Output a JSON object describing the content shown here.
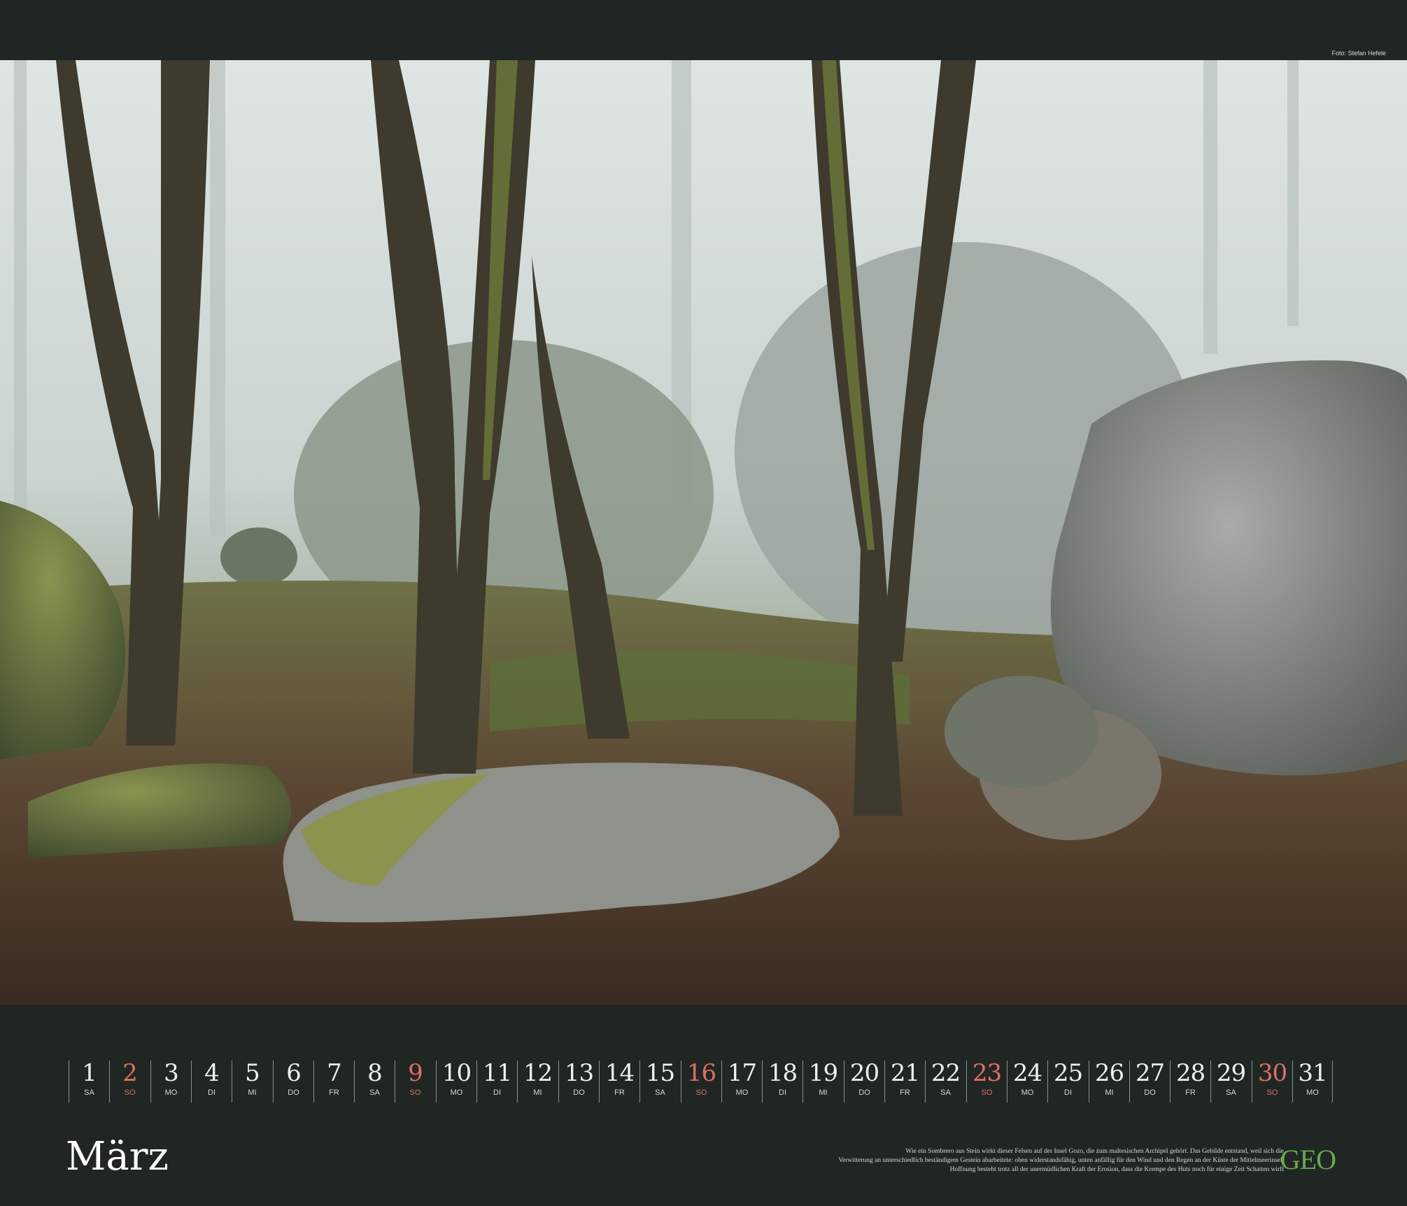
{
  "credit": "Foto: Stefan Hefele",
  "month": "März",
  "days": [
    {
      "num": "1",
      "wd": "SA",
      "sun": false
    },
    {
      "num": "2",
      "wd": "SO",
      "sun": true
    },
    {
      "num": "3",
      "wd": "MO",
      "sun": false
    },
    {
      "num": "4",
      "wd": "DI",
      "sun": false
    },
    {
      "num": "5",
      "wd": "MI",
      "sun": false
    },
    {
      "num": "6",
      "wd": "DO",
      "sun": false
    },
    {
      "num": "7",
      "wd": "FR",
      "sun": false
    },
    {
      "num": "8",
      "wd": "SA",
      "sun": false
    },
    {
      "num": "9",
      "wd": "SO",
      "sun": true
    },
    {
      "num": "10",
      "wd": "MO",
      "sun": false
    },
    {
      "num": "11",
      "wd": "DI",
      "sun": false
    },
    {
      "num": "12",
      "wd": "MI",
      "sun": false
    },
    {
      "num": "13",
      "wd": "DO",
      "sun": false
    },
    {
      "num": "14",
      "wd": "FR",
      "sun": false
    },
    {
      "num": "15",
      "wd": "SA",
      "sun": false
    },
    {
      "num": "16",
      "wd": "SO",
      "sun": true
    },
    {
      "num": "17",
      "wd": "MO",
      "sun": false
    },
    {
      "num": "18",
      "wd": "DI",
      "sun": false
    },
    {
      "num": "19",
      "wd": "MI",
      "sun": false
    },
    {
      "num": "20",
      "wd": "DO",
      "sun": false
    },
    {
      "num": "21",
      "wd": "FR",
      "sun": false
    },
    {
      "num": "22",
      "wd": "SA",
      "sun": false
    },
    {
      "num": "23",
      "wd": "SO",
      "sun": true
    },
    {
      "num": "24",
      "wd": "MO",
      "sun": false
    },
    {
      "num": "25",
      "wd": "DI",
      "sun": false
    },
    {
      "num": "26",
      "wd": "MI",
      "sun": false
    },
    {
      "num": "27",
      "wd": "DO",
      "sun": false
    },
    {
      "num": "28",
      "wd": "FR",
      "sun": false
    },
    {
      "num": "29",
      "wd": "SA",
      "sun": false
    },
    {
      "num": "30",
      "wd": "SO",
      "sun": true
    },
    {
      "num": "31",
      "wd": "MO",
      "sun": false
    }
  ],
  "caption": [
    "Wie ein Sombrero aus Stein wirkt dieser Felsen auf der Insel Gozo, die zum maltesischen Archipel gehört. Das Gebilde entstand, weil sich die",
    "Verwitterung an unterschiedlich beständigem Gestein abarbeitete: oben widerstandsfähig, unten anfällig für den Wind und den Regen an der Küste der Mittelmeerinsel.",
    "Hoffnung besteht trotz all der unermüdlichen Kraft der Erosion, dass die Krempe des Huts noch für einige Zeit Schatten wirft"
  ],
  "logo": "GEO",
  "colors": {
    "background": "#1f2624",
    "sunday": "#e07060",
    "logo": "#6aa84f"
  }
}
